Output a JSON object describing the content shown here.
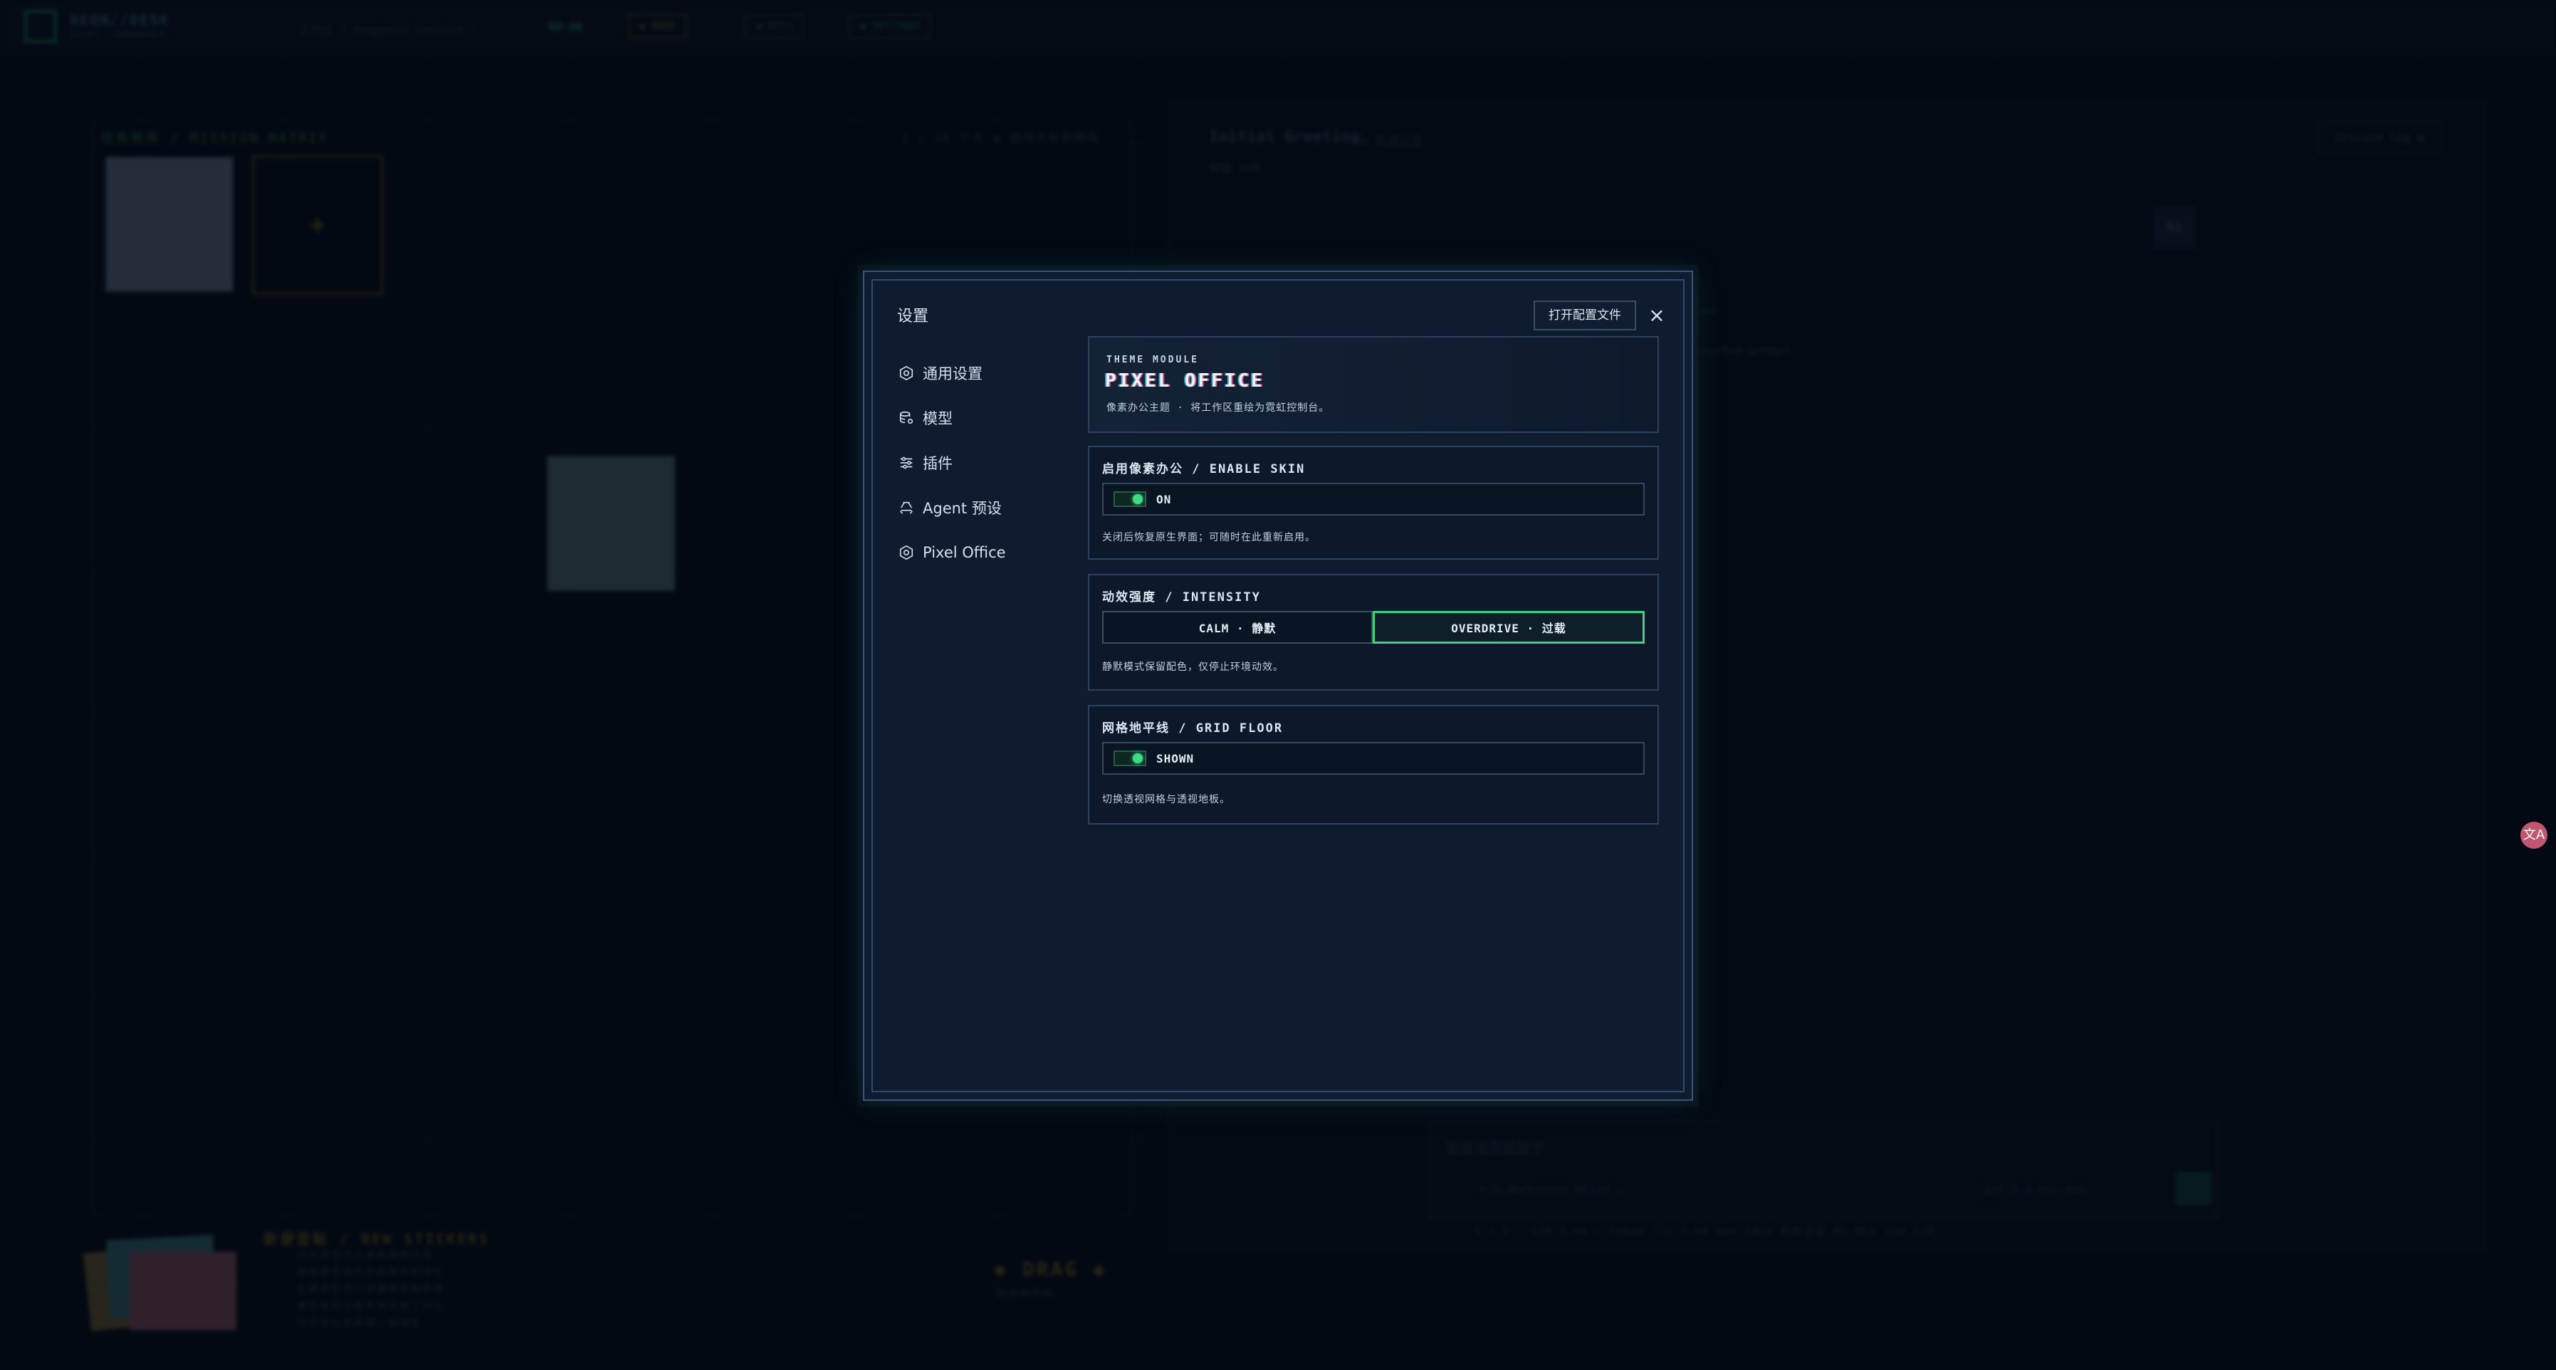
{
  "background": {
    "topbar": {
      "brand": "NEON//DESK",
      "brand_sub": "AGENT · WORKBENCH",
      "path": "工作台 / Response Console /",
      "metric": "00:00",
      "mode_chip": "◆ MODE",
      "data_chip": "◆ DATA",
      "settings_chip": "◆ SETTINGS"
    },
    "left_panel": {
      "title": "任务矩阵 / MISSION MATRIX",
      "right_info": "1 / 16 个卡    ◆ 拖拽卡片到网格",
      "add_symbol": "+"
    },
    "right_panel": {
      "title": "Initial Greeting",
      "subtitle": "◷ 会话记录",
      "tabs": "对话    日志",
      "session_log": "Session log ◍",
      "avatar": "hi",
      "text1": "…ed",
      "text2": "…system-prompt",
      "composer_placeholder": "发送消息给助手",
      "composer_footer": "+    ◫ Workspace Write ⌄",
      "composer_model": "gpt-5.4-xml-max ⌄",
      "status": "4 ↑  3 ↓    128 1.0K    ⌗ token 772 3.0K    896 1024    历史记录 0%    输入 126 530"
    },
    "stickers": {
      "title": "新便签贴 / NEW STICKERS",
      "lines": [
        "— 点击便签可以直接编辑内容",
        "— 拖拽便签到任务矩阵中的空位",
        "— 右键便签可以设置颜色和标签",
        "— 便签会自动保存到本地工作区",
        "— 双击空白处新建一张便签"
      ]
    },
    "drag": {
      "label": "◆ DRAG ◆",
      "sub": "拖拽到网格"
    }
  },
  "translate_button": "文A",
  "settings": {
    "title": "设置",
    "open_config": "打开配置文件",
    "close": "×",
    "nav": [
      {
        "label": "通用设置",
        "icon": "gear-icon"
      },
      {
        "label": "模型",
        "icon": "database-gear-icon"
      },
      {
        "label": "插件",
        "icon": "sliders-icon"
      },
      {
        "label": "Agent 预设",
        "icon": "recycle-icon"
      },
      {
        "label": "Pixel Office",
        "icon": "gear-icon"
      }
    ],
    "theme": {
      "label": "THEME MODULE",
      "title": "PIXEL OFFICE",
      "desc": "像素办公主题 · 将工作区重绘为霓虹控制台。"
    },
    "enable_skin": {
      "title": "启用像素办公 / ENABLE SKIN",
      "state": "ON",
      "note": "关闭后恢复原生界面；可随时在此重新启用。"
    },
    "intensity": {
      "title": "动效强度 / INTENSITY",
      "options": [
        "CALM · 静默",
        "OVERDRIVE · 过载"
      ],
      "selected": "OVERDRIVE · 过载",
      "note": "静默模式保留配色，仅停止环境动效。"
    },
    "grid_floor": {
      "title": "网格地平线 / GRID FLOOR",
      "state": "SHOWN",
      "note": "切换透视网格与透视地板。"
    },
    "colors": {
      "accent": "#3fd27f",
      "panel": "#0f1b2e",
      "border": "#3a5578"
    }
  }
}
